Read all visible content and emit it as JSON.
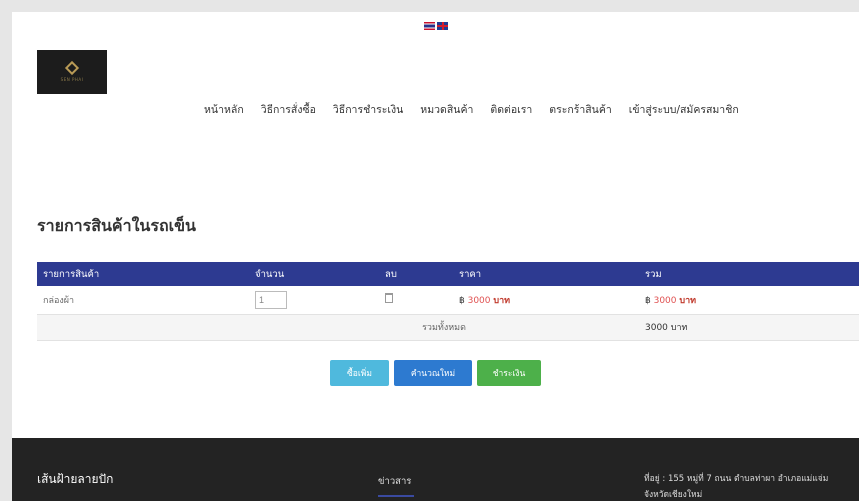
{
  "language_switcher": {
    "items": [
      "Thai",
      "English"
    ]
  },
  "logo": {
    "tagline": "SEN PHAI"
  },
  "nav": {
    "items": [
      "หน้าหลัก",
      "วิธีการสั่งซื้อ",
      "วิธีการชำระเงิน",
      "หมวดสินค้า",
      "ติดต่อเรา",
      "ตระกร้าสินค้า",
      "เข้าสู่ระบบ/สมัครสมาชิก"
    ]
  },
  "cart": {
    "title": "รายการสินค้าในรถเข็น",
    "headers": {
      "product": "รายการสินค้า",
      "quantity": "จำนวน",
      "delete": "ลบ",
      "price": "ราคา",
      "total": "รวม"
    },
    "rows": [
      {
        "product": "กล่องผ้า",
        "quantity": "1",
        "price_symbol": "฿",
        "price_value": "3000",
        "price_unit": "บาท",
        "total_symbol": "฿",
        "total_value": "3000",
        "total_unit": "บาท"
      }
    ],
    "grand_total_label": "รวมทั้งหมด",
    "grand_total_value": "3000 บาท",
    "buttons": {
      "continue": "ซื้อเพิ่ม",
      "recalculate": "คำนวณใหม่",
      "checkout": "ชำระเงิน"
    }
  },
  "footer": {
    "brand": "เส้นฝ้ายลายปัก",
    "news": "ข่าวสาร",
    "address": "ที่อยู่ : 155 หมู่ที่ 7 ถนน ตำบลท่าผา อำเภอแม่แจ่ม จังหวัดเชียงใหม่"
  },
  "colors": {
    "table_header": "#2d3a91",
    "price": "#e05252",
    "btn_continue": "#4fb9dd",
    "btn_recalculate": "#2d7ad0",
    "btn_checkout": "#4db04a",
    "footer": "#232323"
  }
}
